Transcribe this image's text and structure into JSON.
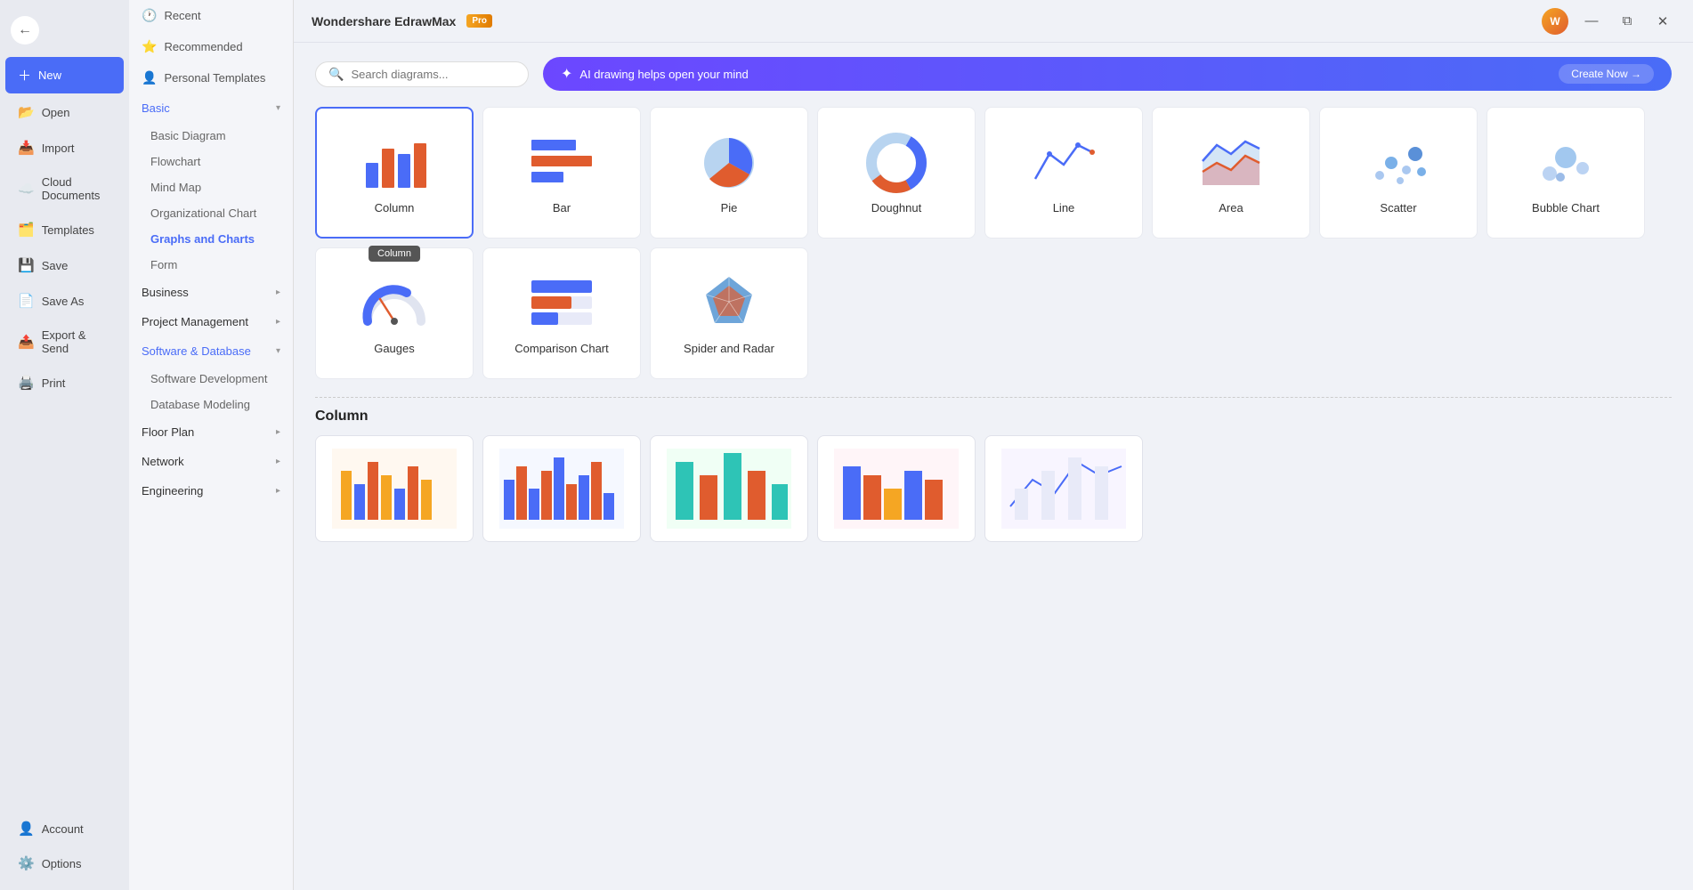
{
  "app": {
    "title": "Wondershare EdrawMax",
    "pro_badge": "Pro"
  },
  "sidebar": {
    "back_label": "←",
    "items": [
      {
        "id": "new",
        "label": "New",
        "icon": "➕",
        "active": true,
        "is_new": true
      },
      {
        "id": "open",
        "label": "Open",
        "icon": "📂"
      },
      {
        "id": "import",
        "label": "Import",
        "icon": "📥"
      },
      {
        "id": "cloud",
        "label": "Cloud Documents",
        "icon": "☁️"
      },
      {
        "id": "templates",
        "label": "Templates",
        "icon": "🗂️"
      },
      {
        "id": "save",
        "label": "Save",
        "icon": "💾"
      },
      {
        "id": "saveas",
        "label": "Save As",
        "icon": "📄"
      },
      {
        "id": "export",
        "label": "Export & Send",
        "icon": "📤"
      },
      {
        "id": "print",
        "label": "Print",
        "icon": "🖨️"
      }
    ],
    "bottom_items": [
      {
        "id": "account",
        "label": "Account",
        "icon": "👤"
      },
      {
        "id": "options",
        "label": "Options",
        "icon": "⚙️"
      }
    ]
  },
  "panel": {
    "items": [
      {
        "id": "recent",
        "label": "Recent",
        "icon": "🕐",
        "type": "item"
      },
      {
        "id": "recommended",
        "label": "Recommended",
        "icon": "⭐",
        "type": "item"
      },
      {
        "id": "personal",
        "label": "Personal Templates",
        "icon": "👤",
        "type": "item"
      }
    ],
    "categories": [
      {
        "id": "basic",
        "label": "Basic",
        "expanded": true,
        "active": true,
        "subitems": [
          {
            "id": "basic-diagram",
            "label": "Basic Diagram"
          },
          {
            "id": "flowchart",
            "label": "Flowchart"
          },
          {
            "id": "mind-map",
            "label": "Mind Map"
          },
          {
            "id": "org-chart",
            "label": "Organizational Chart"
          },
          {
            "id": "graphs",
            "label": "Graphs and Charts",
            "active": true
          },
          {
            "id": "form",
            "label": "Form"
          }
        ]
      },
      {
        "id": "business",
        "label": "Business",
        "expanded": false,
        "subitems": []
      },
      {
        "id": "project",
        "label": "Project Management",
        "expanded": false,
        "subitems": []
      },
      {
        "id": "software",
        "label": "Software & Database",
        "expanded": true,
        "subitems": [
          {
            "id": "software-dev",
            "label": "Software Development"
          },
          {
            "id": "db-modeling",
            "label": "Database Modeling"
          }
        ]
      },
      {
        "id": "floorplan",
        "label": "Floor Plan",
        "expanded": false,
        "subitems": []
      },
      {
        "id": "network",
        "label": "Network",
        "expanded": false,
        "subitems": []
      },
      {
        "id": "engineering",
        "label": "Engineering",
        "expanded": false,
        "subitems": []
      }
    ]
  },
  "search": {
    "placeholder": "Search diagrams..."
  },
  "ai_banner": {
    "icon": "✦",
    "text": "AI drawing helps open your mind",
    "button": "Create Now →"
  },
  "charts": [
    {
      "id": "column",
      "label": "Column",
      "highlighted": true,
      "tooltip": "Column"
    },
    {
      "id": "bar",
      "label": "Bar",
      "highlighted": false
    },
    {
      "id": "pie",
      "label": "Pie",
      "highlighted": false
    },
    {
      "id": "doughnut",
      "label": "Doughnut",
      "highlighted": false
    },
    {
      "id": "line",
      "label": "Line",
      "highlighted": false
    },
    {
      "id": "area",
      "label": "Area",
      "highlighted": false
    },
    {
      "id": "scatter",
      "label": "Scatter",
      "highlighted": false
    },
    {
      "id": "bubble",
      "label": "Bubble Chart",
      "highlighted": false
    },
    {
      "id": "gauges",
      "label": "Gauges",
      "highlighted": false
    },
    {
      "id": "comparison",
      "label": "Comparison Chart",
      "highlighted": false
    },
    {
      "id": "spider",
      "label": "Spider and Radar",
      "highlighted": false
    }
  ],
  "section": {
    "title": "Column"
  },
  "topbar_icons": [
    "?",
    "🔔",
    "⚙️",
    "↑",
    "⚙️"
  ],
  "window_controls": [
    "—",
    "⧉",
    "✕"
  ]
}
